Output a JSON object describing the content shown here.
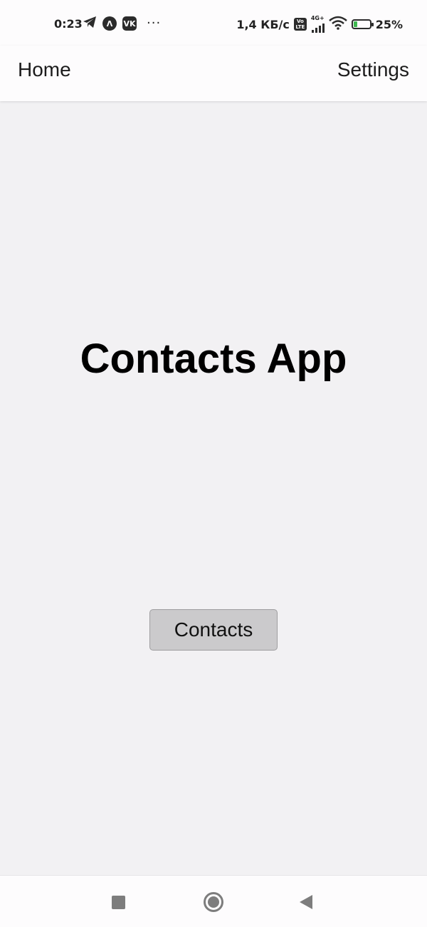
{
  "status_bar": {
    "time": "0:23",
    "network_speed": "1,4 КБ/с",
    "volte_top": "Vo",
    "volte_bottom": "LTE",
    "network_type": "4G+",
    "battery_level": "25%",
    "battery_fraction": 0.25,
    "battery_fill_color": "#3fb950",
    "vk_label": "VK",
    "lambda_label": "Λ",
    "more_label": "···",
    "icons": [
      "telegram-icon",
      "lambda-app-icon",
      "vk-icon",
      "more-notifications-icon",
      "volte-icon",
      "cellular-signal-icon",
      "wifi-icon",
      "battery-charging-icon"
    ]
  },
  "header": {
    "home_label": "Home",
    "settings_label": "Settings"
  },
  "main": {
    "title": "Contacts App",
    "contacts_button_label": "Contacts"
  },
  "nav_bar": {
    "icons": [
      "recents-square-icon",
      "home-circle-icon",
      "back-triangle-icon"
    ]
  },
  "colors": {
    "background": "#f2f1f3",
    "header_background": "#fdfcfd",
    "button_background": "#cbcacc",
    "button_border": "#9e9d9f"
  }
}
